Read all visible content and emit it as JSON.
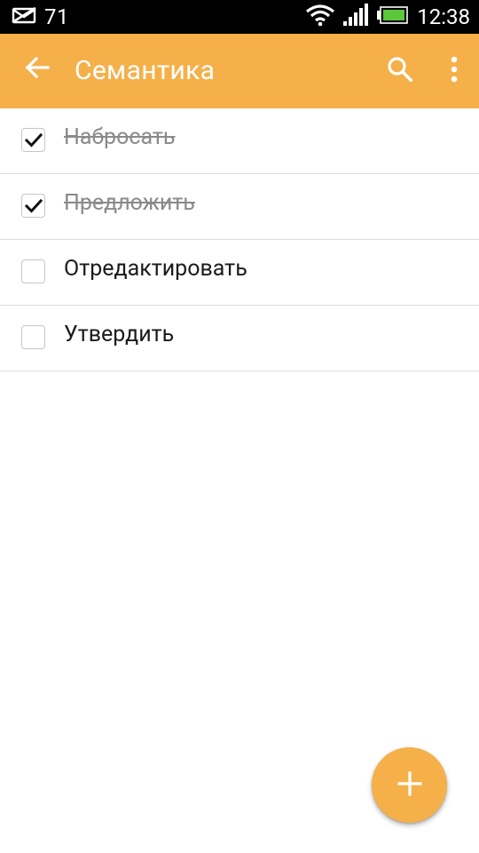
{
  "status_bar": {
    "notification_count": "71",
    "time": "12:38",
    "icons": [
      "envelope-icon",
      "wifi-icon",
      "signal-icon",
      "battery-icon"
    ]
  },
  "app_bar": {
    "title": "Семантика",
    "background": "#f5b04a",
    "icons": [
      "back-arrow-icon",
      "search-icon",
      "more-vert-icon"
    ]
  },
  "list": {
    "items": [
      {
        "label": "Набросать",
        "checked": true
      },
      {
        "label": "Предложить",
        "checked": true
      },
      {
        "label": "Отредактировать",
        "checked": false
      },
      {
        "label": "Утвердить",
        "checked": false
      }
    ]
  },
  "fab": {
    "icon": "plus-icon",
    "color": "#f5b04a"
  }
}
